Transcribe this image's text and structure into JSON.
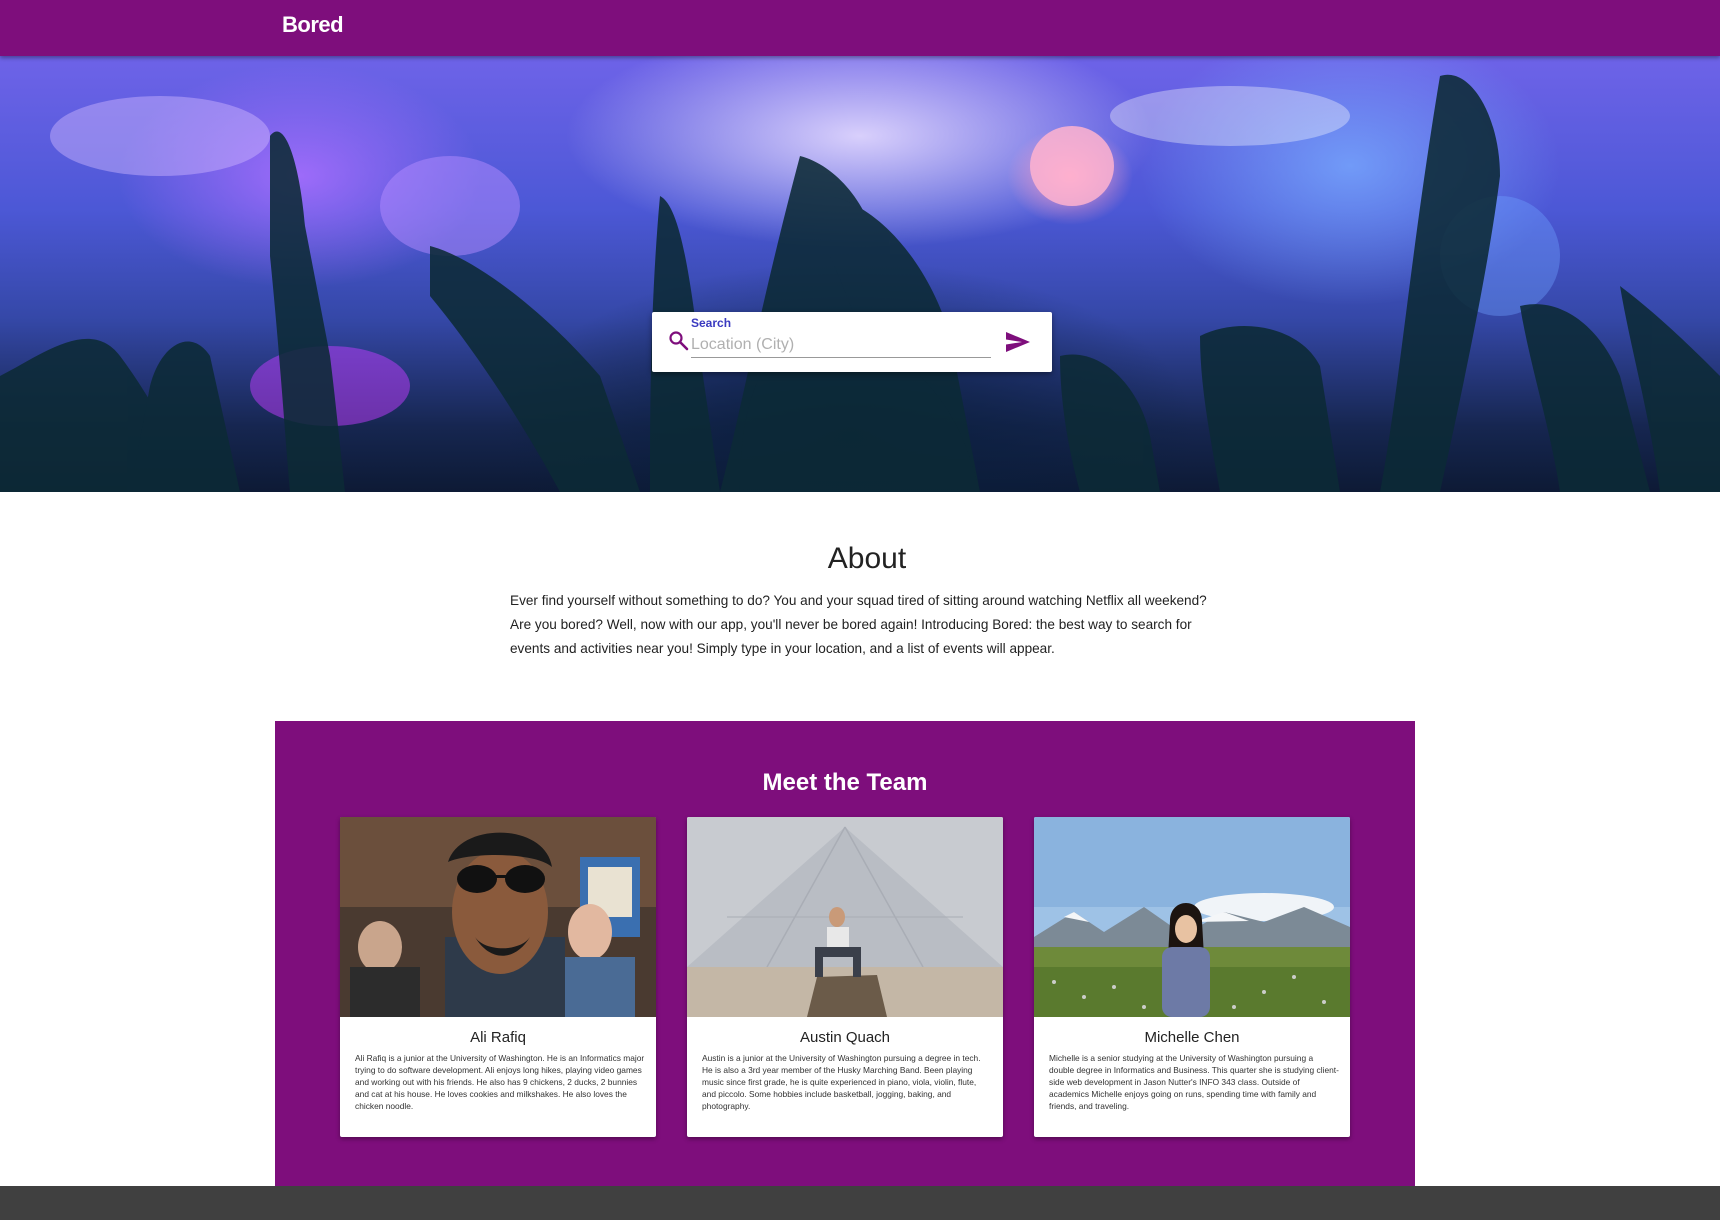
{
  "navbar": {
    "brand": "Bored"
  },
  "hero": {
    "search": {
      "label": "Search",
      "placeholder": "Location (City)",
      "value": "",
      "icon": "search-icon",
      "submit_icon": "send-icon"
    }
  },
  "about": {
    "title": "About",
    "text": "Ever find yourself without something to do? You and your squad tired of sitting around watching Netflix all weekend? Are you bored? Well, now with our app, you'll never be bored again! Introducing Bored: the best way to search for events and activities near you! Simply type in your location, and a list of events will appear."
  },
  "team": {
    "title": "Meet the Team",
    "members": [
      {
        "name": "Ali Rafiq",
        "bio": "Ali Rafiq is a junior at the University of Washington. He is an Informatics major trying to do software development. Ali enjoys long hikes, playing video games and working out with his friends. He also has 9 chickens, 2 ducks, 2 bunnies and cat at his house. He loves cookies and milkshakes. He also loves the chicken noodle."
      },
      {
        "name": "Austin Quach",
        "bio": "Austin is a junior at the University of Washington pursuing a degree in tech. He is also a 3rd year member of the Husky Marching Band. Been playing music since first grade, he is quite experienced in piano, viola, violin, flute, and piccolo. Some hobbies include basketball, jogging, baking, and photography."
      },
      {
        "name": "Michelle Chen",
        "bio": "Michelle is a senior studying at the University of Washington pursuing a double degree in Informatics and Business. This quarter she is studying client-side web development in Jason Nutter's INFO 343 class. Outside of academics Michelle enjoys going on runs, spending time with family and friends, and traveling."
      }
    ]
  },
  "colors": {
    "brand_purple": "#7e0e7c",
    "footer": "#404040"
  }
}
